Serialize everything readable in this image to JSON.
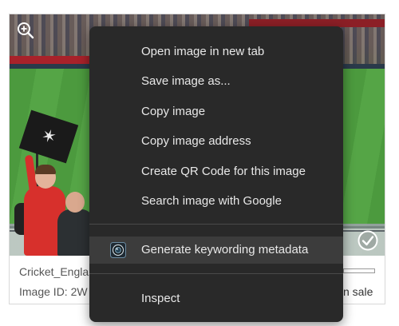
{
  "card": {
    "title": "Cricket_Engla",
    "image_id": "Image ID: 2W",
    "sale": "n sale"
  },
  "icons": {
    "zoom": "zoom-in-icon",
    "select": "checkmark-circle-icon",
    "extension": "camera-lens-icon"
  },
  "colors": {
    "menu_bg": "#292929",
    "menu_highlight": "#3c3c3c",
    "menu_text": "#e8e8e8"
  },
  "context_menu": {
    "items": [
      {
        "label": "Open image in new tab"
      },
      {
        "label": "Save image as..."
      },
      {
        "label": "Copy image"
      },
      {
        "label": "Copy image address"
      },
      {
        "label": "Create QR Code for this image"
      },
      {
        "label": "Search image with Google"
      }
    ],
    "extension_item": {
      "label": "Generate keywording metadata"
    },
    "inspect": {
      "label": "Inspect"
    }
  }
}
